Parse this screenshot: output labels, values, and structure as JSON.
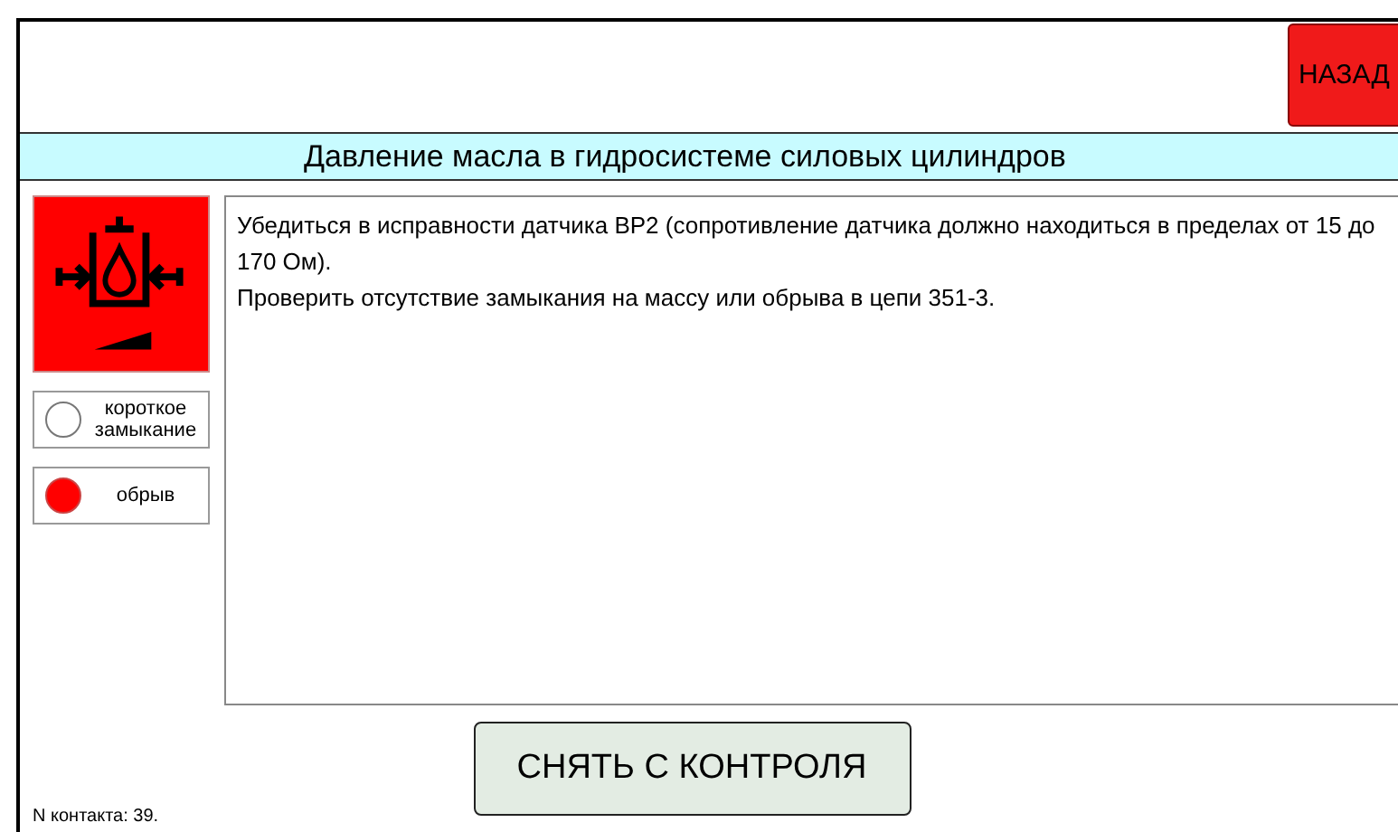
{
  "header": {
    "back_button": "НАЗАД"
  },
  "title": "Давление масла в гидросистеме силовых цилиндров",
  "indicators": [
    {
      "label": "короткое замыкание",
      "active": false
    },
    {
      "label": "обрыв",
      "active": true
    }
  ],
  "instructions": [
    "Убедиться в исправности датчика ВР2 (сопротивление датчика должно находиться в пределах от 15 до 170 Ом).",
    "Проверить отсутствие замыкания на массу или обрыва в цепи 351-3."
  ],
  "action_button": "СНЯТЬ С КОНТРОЛЯ",
  "footer": "N контакта: 39."
}
